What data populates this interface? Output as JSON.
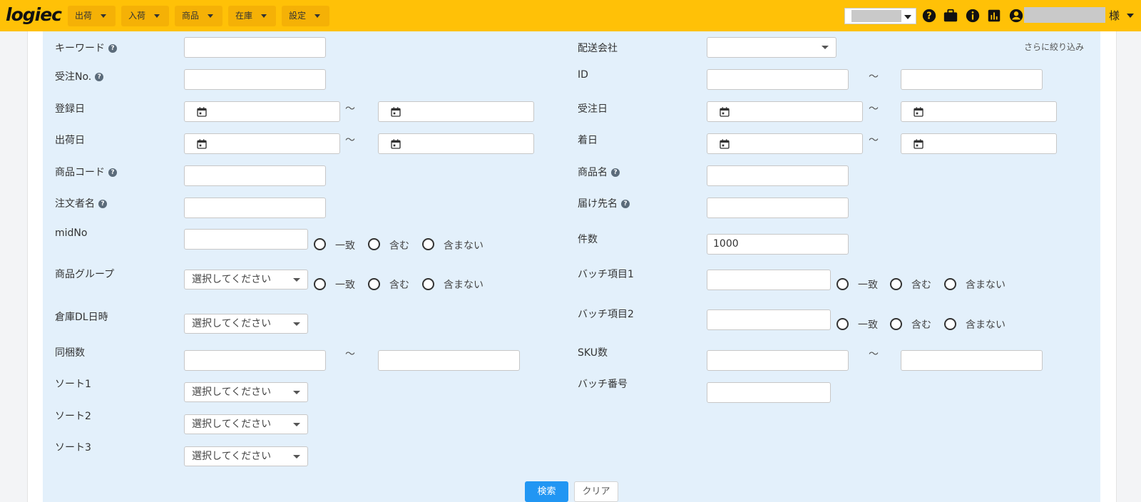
{
  "header": {
    "logo": "logiec",
    "menu": [
      {
        "label": "出荷"
      },
      {
        "label": "入荷"
      },
      {
        "label": "商品"
      },
      {
        "label": "在庫"
      },
      {
        "label": "設定"
      }
    ],
    "user_suffix": "様",
    "icons": [
      "help-icon",
      "briefcase-icon",
      "info-icon",
      "chart-icon",
      "account-icon"
    ]
  },
  "form": {
    "left": {
      "keyword": "キーワード",
      "order_no": "受注No.",
      "registered_date": "登録日",
      "ship_date": "出荷日",
      "product_code": "商品コード",
      "orderer_name": "注文者名",
      "mid_no": "midNo",
      "product_group": "商品グループ",
      "warehouse_dl": "倉庫DL日時",
      "bundle_count": "同梱数",
      "sort1": "ソート1",
      "sort2": "ソート2",
      "sort3": "ソート3"
    },
    "right": {
      "carrier": "配送会社",
      "refine": "さらに絞り込み",
      "id": "ID",
      "order_date": "受注日",
      "arrival_date": "着日",
      "product_name": "商品名",
      "recipient_name": "届け先名",
      "count": "件数",
      "count_value": "1000",
      "batch1": "バッチ項目1",
      "batch2": "バッチ項目2",
      "sku_count": "SKU数",
      "batch_no": "バッチ番号"
    },
    "select_placeholder": "選択してください",
    "range_sep": "〜",
    "match_options": {
      "exact": "一致",
      "contains": "含む",
      "excludes": "含まない"
    }
  },
  "actions": {
    "search": "検索",
    "clear": "クリア"
  },
  "colors": {
    "header": "#ffc107",
    "panel": "#e3f0fb",
    "primary": "#2196f3"
  }
}
